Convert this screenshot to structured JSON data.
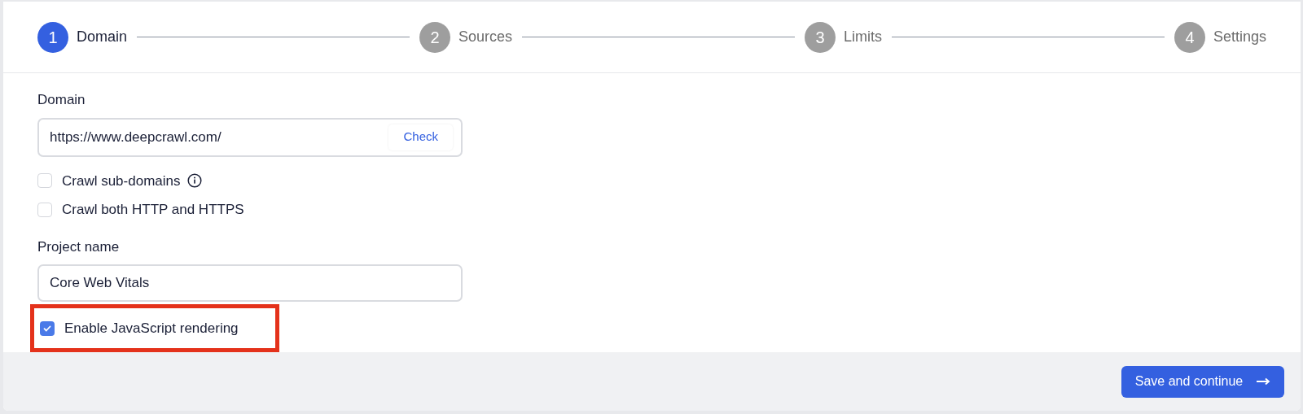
{
  "steps": [
    {
      "number": "1",
      "label": "Domain",
      "selected": true
    },
    {
      "number": "2",
      "label": "Sources",
      "selected": false
    },
    {
      "number": "3",
      "label": "Limits",
      "selected": false
    },
    {
      "number": "4",
      "label": "Settings",
      "selected": false
    }
  ],
  "domain": {
    "label": "Domain",
    "value": "https://www.deepcrawl.com/",
    "button": "Check"
  },
  "domain_options": [
    {
      "label": "Crawl sub-domains",
      "checked": false,
      "info": true
    },
    {
      "label": "Crawl both HTTP and HTTPS",
      "checked": false,
      "info": false
    }
  ],
  "project": {
    "label": "Project name",
    "value": "Core Web Vitals"
  },
  "js_rendering": {
    "label": "Enable JavaScript rendering",
    "checked": true,
    "highlighted": true
  },
  "footer": {
    "button": "Save and continue"
  }
}
